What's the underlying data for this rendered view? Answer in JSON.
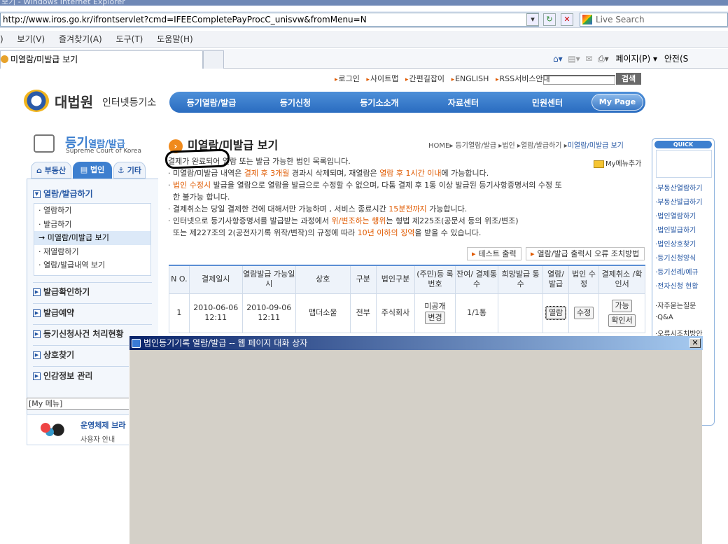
{
  "browser": {
    "window_title": "보기 - Windows Internet Explorer",
    "url": "http://www.iros.go.kr/ifrontservlet?cmd=IFEECompletePayProcC_unisvw&fromMenu=N",
    "url_domain": "iros.go.kr",
    "search_placeholder": "Live Search",
    "menu": [
      "보기(V)",
      "즐겨찾기(A)",
      "도구(T)",
      "도움말(H)"
    ],
    "menu_first": ")",
    "tab_title": "미열람/미발급 보기",
    "cmd_page": "페이지(P) ▾",
    "cmd_safety": "안전(S"
  },
  "header": {
    "toplinks": [
      "로그인",
      "사이트맵",
      "간편길잡이",
      "ENGLISH",
      "RSS서비스안내"
    ],
    "search_button": "검색",
    "logo_main": "대법원",
    "logo_sub": "인터넷등기소",
    "gnb": [
      "등기열람/발급",
      "등기신청",
      "등기소소개",
      "자료센터",
      "민원센터"
    ],
    "mypage": "My Page"
  },
  "sidebar": {
    "title_big": "등기",
    "title_small": "열람/발급",
    "title_en": "Supreme Court of Korea",
    "tabs": [
      "부동산",
      "법인",
      "기타"
    ],
    "section": "열람/발급하기",
    "items": [
      "· 열람하기",
      "· 발급하기",
      "→ 미열람/미발급 보기",
      "· 재열람하기",
      "· 열람/발급내역 보기"
    ],
    "links": [
      "발급확인하기",
      "발급예약",
      "등기신청사건 처리현황",
      "상호찾기",
      "인감정보 관리"
    ],
    "mymenu": "[My 메뉴]",
    "os_title": "운영체제 브라",
    "os_sub": "사용자 안내"
  },
  "main": {
    "title": "미열람/미발급 보기",
    "breadcrumb_home": "HOME",
    "breadcrumb": [
      "등기열람/발급",
      "법인",
      "열람/발급하기",
      "미열람/미발급 보기"
    ],
    "mymenu_add": "My메뉴추가",
    "notice": {
      "l1": "결제가 완료되어 열람 또는 발급 가능한 법인 목록입니다.",
      "l2a": "· 미열람/미발급 내역은 ",
      "l2b": "결제 후 3개월",
      "l2c": " 경과시 삭제되며, 재열람은 ",
      "l2d": "열람 후 1시간 이내",
      "l2e": "에 가능합니다.",
      "l3a": "· ",
      "l3b": "법인 수정시",
      "l3c": " 발급을 열람으로 열람을 발급으로 수정할 수 없으며, 다툼 결제 후 1통 이상 발급된 등기사항증명서의 수정 또",
      "l4": "  한 불가능 합니다.",
      "l5a": "· 결제취소는 당일 결제한 건에 대해서만 가능하며 , 서비스 종료시간 ",
      "l5b": "15분전까지",
      "l5c": " 가능합니다.",
      "l6a": "· 인터넷으로 등기사항증명서를 발급받는 과정에서 ",
      "l6b": "위/변조하는 행위",
      "l6c": "는 형법 제225조(공문서 등의 위조/변조)",
      "l7a": "  또는 제227조의 2(공전자기록 위작/변작)의 규정에 따라 ",
      "l7b": "10년 이하의 징역",
      "l7c": "을 받을 수 있습니다."
    },
    "btn_test": "테스트 출력",
    "btn_error": "열람/발급 출력시 오류 조치방법",
    "table": {
      "headers": [
        "N O.",
        "결제일시",
        "열람발급 가능일시",
        "상호",
        "구분",
        "법인구분",
        "(주민)등 록번호",
        "잔여/ 결제통수",
        "희망발급 통수",
        "열람/ 발급",
        "법인 수정",
        "결제취소 /확인서"
      ],
      "row": {
        "no": "1",
        "paid": "2010-06-06 12:11",
        "avail": "2010-09-06 12:11",
        "name": "맵더소울",
        "kind": "전부",
        "corp": "주식회사",
        "regno": "미공개",
        "regno_btn": "변경",
        "remain": "1/1통",
        "wish": "",
        "view_btn": "열람",
        "edit_btn": "수정",
        "cancel_btn": "가능",
        "confirm_btn": "확인서"
      }
    }
  },
  "quick": {
    "header": "QUICK",
    "links": [
      "·부동산열람하기",
      "·부동산발급하기",
      "·법인열람하기",
      "·법인발급하기",
      "·법인상호찾기",
      "·등기신청양식",
      "·등기선례/예규",
      "·전자신청 현황"
    ],
    "links2": [
      "·자주묻는질문",
      "·Q&A",
      "·오류시조치방안"
    ]
  },
  "dialog": {
    "title": "법인등기기록 열람/발급 -- 웹 페이지 대화 상자",
    "close": "✕"
  },
  "colors": {
    "accent_blue": "#3d7fcf",
    "orange": "#e05a00",
    "dialog_title": "#0a246a"
  }
}
